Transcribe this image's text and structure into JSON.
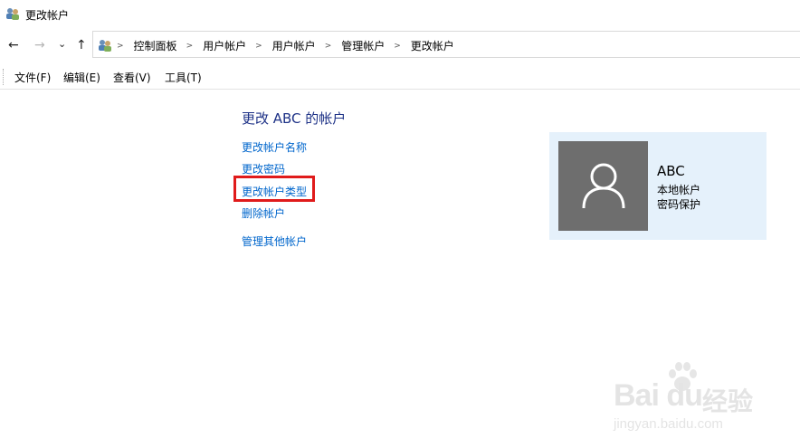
{
  "window": {
    "title": "更改帐户"
  },
  "nav": {
    "back": "←",
    "forward": "→",
    "recent": "⌄",
    "up": "↑"
  },
  "address": {
    "crumbs": [
      "控制面板",
      "用户帐户",
      "用户帐户",
      "管理帐户",
      "更改帐户"
    ]
  },
  "menu": {
    "items": [
      "文件(F)",
      "编辑(E)",
      "查看(V)",
      "工具(T)"
    ]
  },
  "main": {
    "heading": "更改 ABC 的帐户",
    "links": [
      "更改帐户名称",
      "更改密码",
      "更改帐户类型",
      "删除帐户"
    ],
    "other_link": "管理其他帐户"
  },
  "account": {
    "name": "ABC",
    "type": "本地帐户",
    "protection": "密码保护"
  },
  "watermark": {
    "brand": "Bai du",
    "brand_cn": "经验",
    "url": "jingyan.baidu.com"
  },
  "colors": {
    "link": "#0066cc",
    "heading": "#1e3287",
    "highlight": "#e01b1b",
    "card_bg": "#e5f1fb",
    "avatar_bg": "#6e6e6e"
  },
  "icons": {
    "app": "users-icon",
    "avatar": "user-silhouette-icon"
  }
}
